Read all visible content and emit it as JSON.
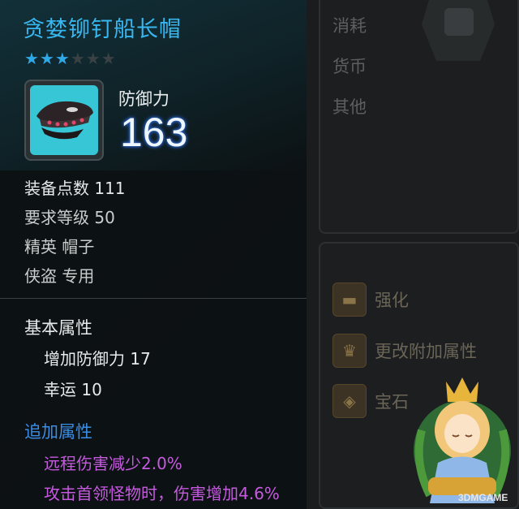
{
  "item": {
    "name": "贪婪铆钉船长帽",
    "stars_filled": 3,
    "stars_total": 6,
    "defense_label": "防御力",
    "defense_value": "163",
    "equip_points": "装备点数 111",
    "required_level": "要求等级 50",
    "grade_type": "精英 帽子",
    "class_restriction": "侠盗 专用",
    "icon": "captain-hat-icon"
  },
  "basic_attributes": {
    "title": "基本属性",
    "items": [
      "增加防御力 17",
      "幸运 10"
    ]
  },
  "additional_attributes": {
    "title": "追加属性",
    "items": [
      "远程伤害减少2.0%",
      "攻击首领怪物时，伤害增加4.6%"
    ]
  },
  "resources": {
    "labels": [
      "消耗",
      "货币",
      "其他"
    ]
  },
  "actions": {
    "items": [
      {
        "label": "强化",
        "icon": "anvil-icon"
      },
      {
        "label": "更改附加属性",
        "icon": "trophy-icon"
      },
      {
        "label": "宝石",
        "icon": "gem-icon"
      }
    ]
  },
  "watermark": "3DMGAME",
  "colors": {
    "item_name": "#38b6ee",
    "star_on": "#2fa8e6",
    "additional_title": "#3a8de6",
    "additional_attr": "#c55adf"
  }
}
